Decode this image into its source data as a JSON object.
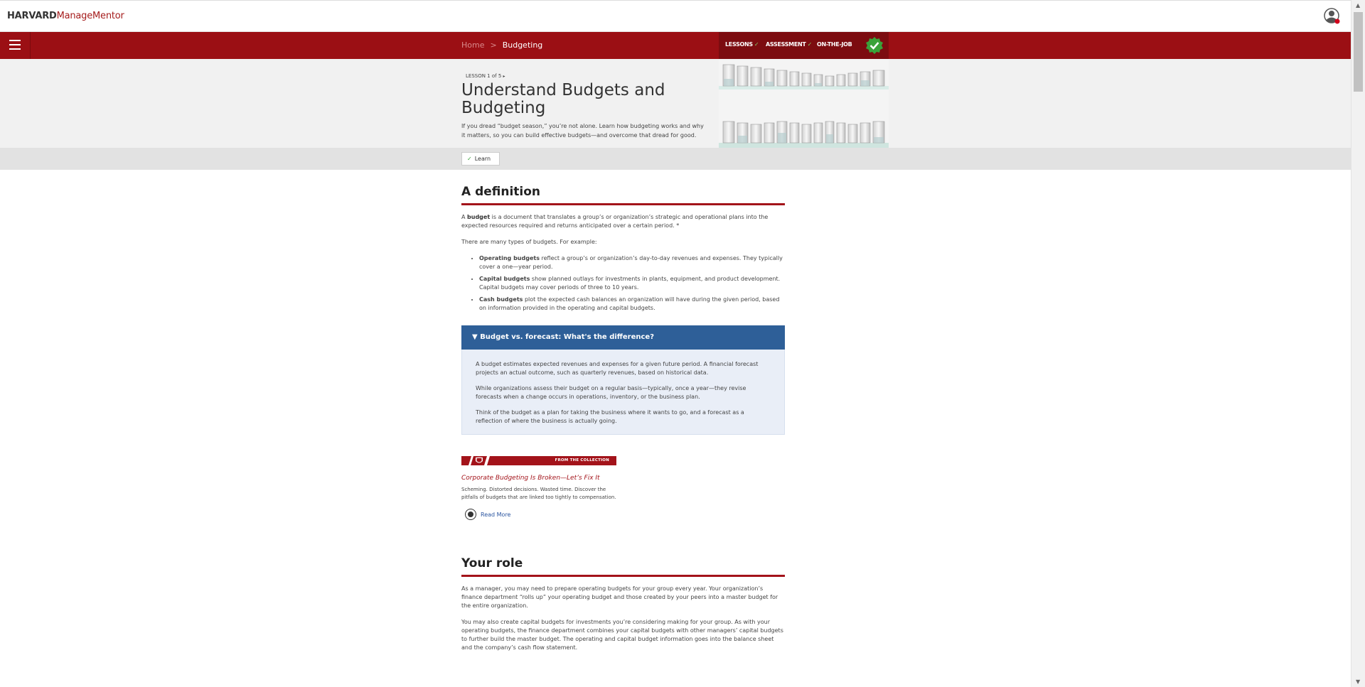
{
  "brand": {
    "harvard": "HARVARD",
    "product": "ManageMentor"
  },
  "nav": {
    "breadcrumb_home": "Home",
    "breadcrumb_sep": ">",
    "breadcrumb_current": "Budgeting",
    "tabs": [
      {
        "label": "LESSONS",
        "completed": true
      },
      {
        "label": "ASSESSMENT",
        "completed": true
      },
      {
        "label": "ON-THE-JOB",
        "completed": false
      }
    ],
    "check": "✓"
  },
  "hero": {
    "lesson_label": "LESSON 1 of 5",
    "title": "Understand Budgets and Budgeting",
    "description": "If you dread “budget season,” you’re not alone. Learn how budgeting works and why it matters, so you can build effective budgets—and overcome that dread for good."
  },
  "learn_tab": {
    "label": "Learn",
    "check": "✓"
  },
  "definition": {
    "heading": "A definition",
    "intro_term": "budget",
    "intro_before": "A ",
    "intro_after": " is a document that translates a group’s or organization’s strategic and operational plans into the expected resources required and returns anticipated over a certain period. *",
    "types_intro": "There are many types of budgets. For example:",
    "types": [
      {
        "term": "Operating budgets",
        "text": " reflect a group’s or organization’s day-to-day revenues and expenses. They typically cover a one—year period."
      },
      {
        "term": "Capital budgets",
        "text": " show planned outlays for investments in plants, equipment, and product development. Capital budgets may cover periods of three to 10 years."
      },
      {
        "term": "Cash budgets",
        "text": " plot the expected cash balances an organization will have during the given period, based on information provided in the operating and capital budgets."
      }
    ]
  },
  "accordion": {
    "title": "Budget vs. forecast: What's the difference?",
    "paragraphs": [
      "A budget estimates expected revenues and expenses for a given future period. A financial forecast projects an actual outcome, such as quarterly revenues, based on historical data.",
      "While organizations assess their budget on a regular basis—typically, once a year—they revise forecasts when a change occurs in operations, inventory, or the business plan.",
      "Think of the budget as a plan for taking the business where it wants to go, and a forecast as a reflection of where the business is actually going."
    ]
  },
  "collection": {
    "banner": "FROM THE COLLECTION",
    "title": "Corporate Budgeting Is Broken—Let’s Fix It",
    "description": "Scheming. Distorted decisions. Wasted time. Discover the pitfalls of budgets that are linked too tightly to compensation.",
    "read_more": "Read More"
  },
  "role": {
    "heading": "Your role",
    "paragraphs": [
      "As a manager, you may need to prepare operating budgets for your group every year. Your organization’s finance department “rolls up” your operating budget and those created by your peers into a master budget for the entire organization.",
      "You may also create capital budgets for investments you’re considering making for your group. As with your operating budgets, the finance department combines your capital budgets with other managers’ capital budgets to further build the master budget. The operating and capital budget information goes into the balance sheet and the company’s cash flow statement."
    ]
  },
  "colors": {
    "brand_red": "#9b0f14",
    "accordion_blue": "#2e5f98",
    "success_green": "#3aa23a"
  }
}
